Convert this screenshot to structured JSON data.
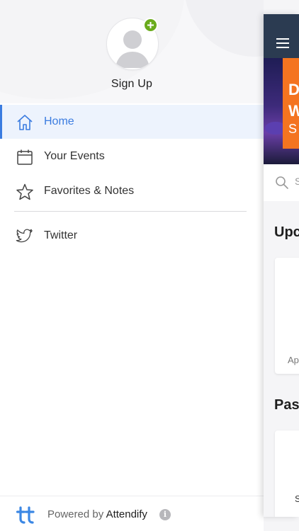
{
  "profile": {
    "signup_label": "Sign Up"
  },
  "nav": {
    "items": [
      {
        "label": "Home",
        "icon": "home-icon",
        "active": true
      },
      {
        "label": "Your Events",
        "icon": "calendar-icon",
        "active": false
      },
      {
        "label": "Favorites & Notes",
        "icon": "star-icon",
        "active": false
      },
      {
        "label": "Twitter",
        "icon": "twitter-icon",
        "active": false
      }
    ]
  },
  "footer": {
    "powered_prefix": "Powered by",
    "brand": "Attendify",
    "info_glyph": "i"
  },
  "peek": {
    "heading_upcoming": "Upc",
    "heading_past": "Pas",
    "search_fragment": "S",
    "card_upcoming_caption": "Ap",
    "card_past_caption": "S",
    "banner_letters": [
      "D",
      "W",
      "S"
    ]
  },
  "colors": {
    "accent": "#3b7ce0",
    "active_bg": "#edf3fd",
    "badge_green": "#6aab1c",
    "topbar": "#2b3b51",
    "banner_orange": "#f47420"
  }
}
